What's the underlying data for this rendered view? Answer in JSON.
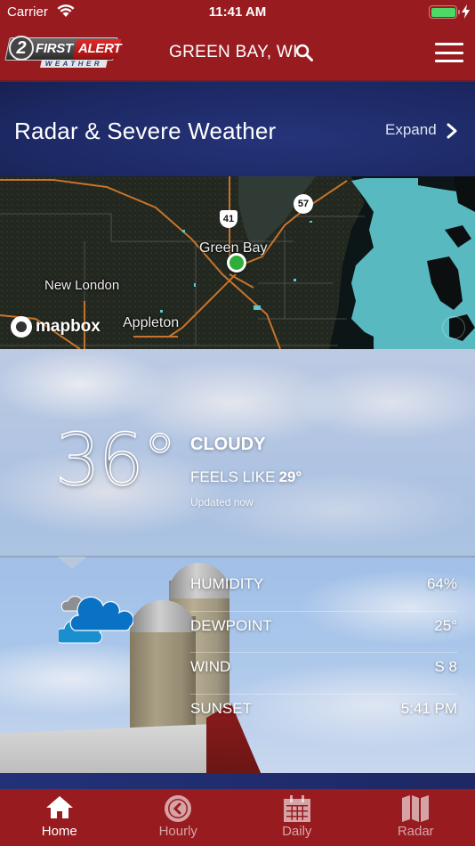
{
  "status_bar": {
    "carrier": "Carrier",
    "time": "11:41 AM",
    "battery_level": 1.0,
    "charging": true
  },
  "header": {
    "logo": {
      "number": "2",
      "first": "FIRST",
      "alert": "ALERT",
      "sub": "WEATHER"
    },
    "location": "GREEN BAY, WI",
    "icons": [
      "search-icon",
      "menu-icon"
    ]
  },
  "radar": {
    "title": "Radar & Severe Weather",
    "expand_label": "Expand",
    "map": {
      "labels": [
        "Green Bay",
        "New London",
        "Appleton"
      ],
      "shields": [
        "41",
        "57"
      ],
      "attribution": "mapbox",
      "radar_color": "#5ec8d0"
    }
  },
  "current": {
    "temperature": "36°",
    "condition": "CLOUDY",
    "feels_like_label": "FEELS LIKE",
    "feels_like_value": "29°",
    "updated": "Updated now",
    "icon": "cloudy-icon",
    "stats": [
      {
        "label": "HUMIDITY",
        "value": "64%"
      },
      {
        "label": "DEWPOINT",
        "value": "25°"
      },
      {
        "label": "WIND",
        "value": "S 8"
      },
      {
        "label": "SUNSET",
        "value": "5:41 PM"
      }
    ]
  },
  "tabs": [
    {
      "label": "Home",
      "icon": "home-icon",
      "active": true
    },
    {
      "label": "Hourly",
      "icon": "clock-icon",
      "active": false
    },
    {
      "label": "Daily",
      "icon": "calendar-icon",
      "active": false
    },
    {
      "label": "Radar",
      "icon": "map-icon",
      "active": false
    }
  ],
  "colors": {
    "brand_red": "#981b20",
    "brand_navy": "#1f2b6a",
    "location_pin": "#2fae3a"
  }
}
